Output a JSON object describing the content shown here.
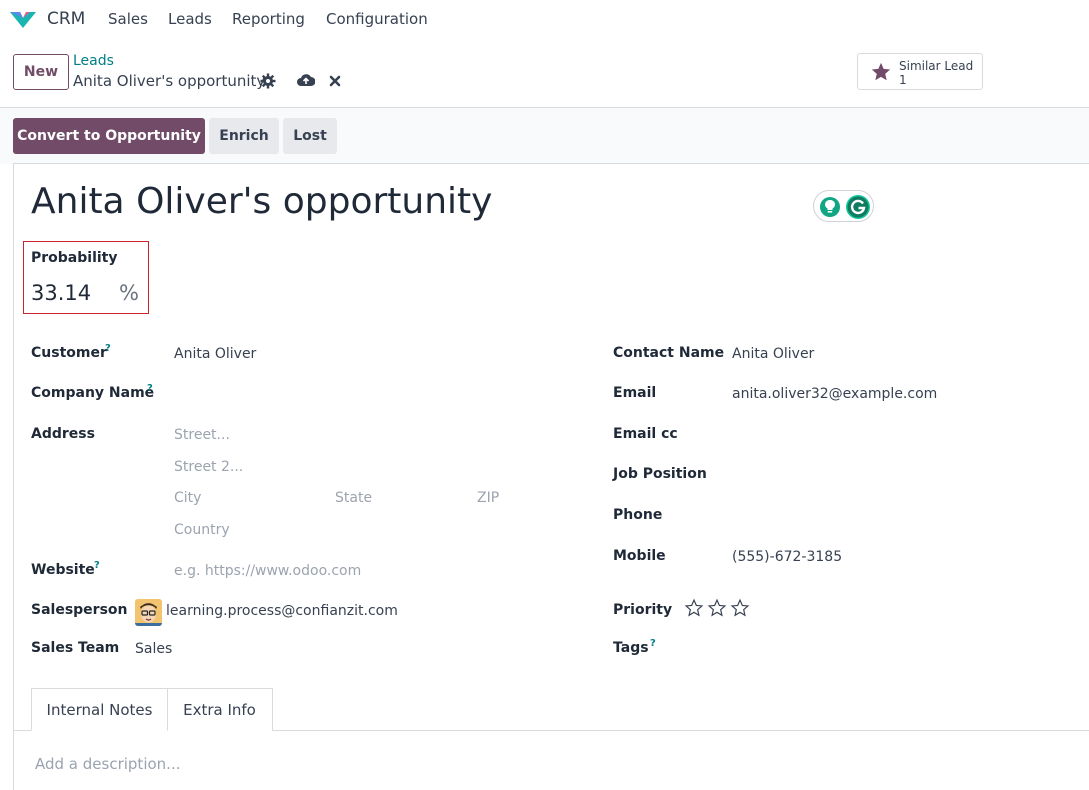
{
  "navbar": {
    "app_name": "CRM",
    "menu": [
      "Sales",
      "Leads",
      "Reporting",
      "Configuration"
    ]
  },
  "control_panel": {
    "new_label": "New",
    "breadcrumb_parent": "Leads",
    "breadcrumb_current": "Anita Oliver's opportunity",
    "similar_label": "Similar Lead",
    "similar_count": "1"
  },
  "actions": {
    "convert": "Convert to Opportunity",
    "enrich": "Enrich",
    "lost": "Lost"
  },
  "form": {
    "title": "Anita Oliver's opportunity",
    "probability_label": "Probability",
    "probability_value": "33.14",
    "probability_unit": "%",
    "left": {
      "customer_label": "Customer",
      "customer_value": "Anita Oliver",
      "company_label": "Company Name",
      "address_label": "Address",
      "street_ph": "Street...",
      "street2_ph": "Street 2...",
      "city_ph": "City",
      "state_ph": "State",
      "zip_ph": "ZIP",
      "country_ph": "Country",
      "website_label": "Website",
      "website_ph": "e.g. https://www.odoo.com",
      "salesperson_label": "Salesperson",
      "salesperson_value": "learning.process@confianzit.com",
      "sales_team_label": "Sales Team",
      "sales_team_value": "Sales"
    },
    "right": {
      "contact_label": "Contact Name",
      "contact_value": "Anita Oliver",
      "email_label": "Email",
      "email_value": "anita.oliver32@example.com",
      "email_cc_label": "Email cc",
      "job_label": "Job Position",
      "phone_label": "Phone",
      "mobile_label": "Mobile",
      "mobile_value": "(555)-672-3185",
      "priority_label": "Priority",
      "priority_value": 0,
      "tags_label": "Tags"
    },
    "help_mark": "?"
  },
  "tabs": [
    "Internal Notes",
    "Extra Info"
  ],
  "notes_placeholder": "Add a description...",
  "colors": {
    "brand": "#714b67",
    "link": "#017e84",
    "highlight_border": "#c8252c"
  }
}
